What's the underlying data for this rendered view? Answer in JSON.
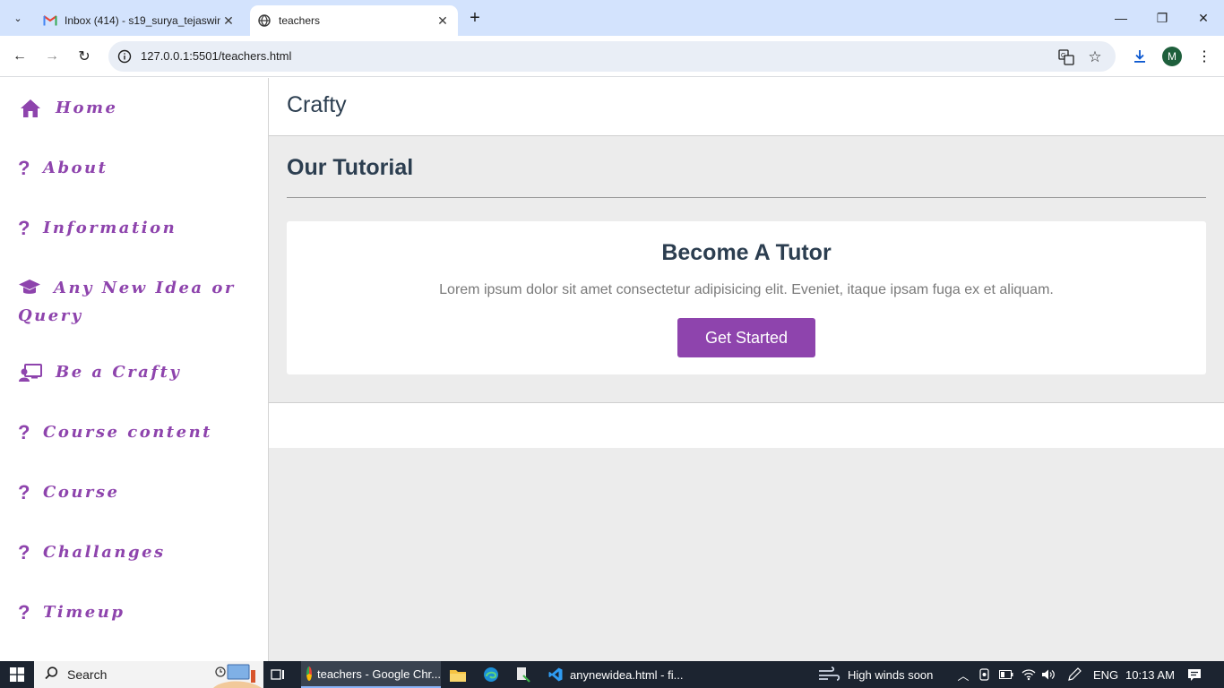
{
  "browser": {
    "tabs": [
      {
        "title": "Inbox (414) - s19_surya_tejaswini",
        "icon": "gmail-icon"
      },
      {
        "title": "teachers",
        "icon": "globe-icon"
      }
    ],
    "url": "127.0.0.1:5501/teachers.html",
    "profile_initial": "M"
  },
  "sidebar": {
    "items": [
      {
        "label": "Home",
        "icon": "home-icon"
      },
      {
        "label": "About",
        "icon": "question-icon"
      },
      {
        "label": "Information",
        "icon": "question-icon"
      },
      {
        "label": "Any New Idea or Query",
        "icon": "graduation-cap-icon"
      },
      {
        "label": "Be a Crafty",
        "icon": "chalkboard-teacher-icon"
      },
      {
        "label": "Course content",
        "icon": "question-icon"
      },
      {
        "label": "Course",
        "icon": "question-icon"
      },
      {
        "label": "Challanges",
        "icon": "question-icon"
      },
      {
        "label": "Timeup",
        "icon": "question-icon"
      }
    ]
  },
  "main": {
    "brand": "Crafty",
    "section_title": "Our Tutorial",
    "card": {
      "title": "Become A Tutor",
      "text": "Lorem ipsum dolor sit amet consectetur adipisicing elit. Eveniet, itaque ipsam fuga ex et aliquam.",
      "button": "Get Started"
    }
  },
  "taskbar": {
    "search_placeholder": "Search",
    "apps": [
      {
        "label": "teachers - Google Chr...",
        "active": true
      },
      {
        "label": "anynewidea.html - fi...",
        "active": false
      }
    ],
    "weather": "High winds soon",
    "language": "ENG",
    "time": "10:13 AM"
  },
  "colors": {
    "accent": "#8e44ad",
    "heading": "#2c3e50",
    "page_bg": "#ececec"
  }
}
